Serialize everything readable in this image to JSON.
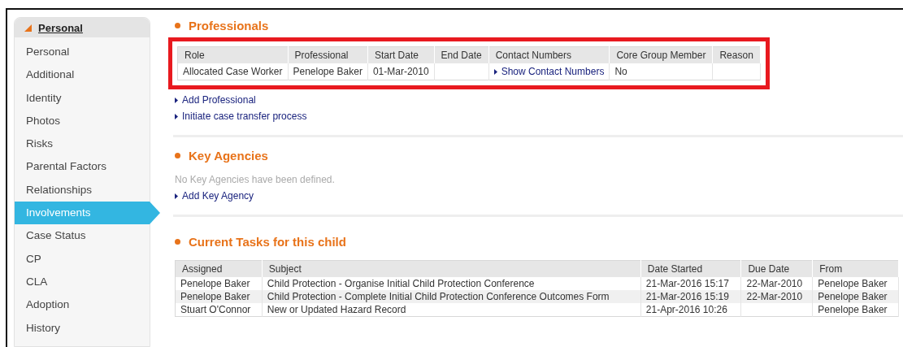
{
  "sidebar": {
    "header": "Personal",
    "items": [
      {
        "label": "Personal",
        "selected": false
      },
      {
        "label": "Additional",
        "selected": false
      },
      {
        "label": "Identity",
        "selected": false
      },
      {
        "label": "Photos",
        "selected": false
      },
      {
        "label": "Risks",
        "selected": false
      },
      {
        "label": "Parental Factors",
        "selected": false
      },
      {
        "label": "Relationships",
        "selected": false
      },
      {
        "label": "Involvements",
        "selected": true
      },
      {
        "label": "Case Status",
        "selected": false
      },
      {
        "label": "CP",
        "selected": false
      },
      {
        "label": "CLA",
        "selected": false
      },
      {
        "label": "Adoption",
        "selected": false
      },
      {
        "label": "History",
        "selected": false
      }
    ]
  },
  "professionals": {
    "title": "Professionals",
    "highlighted": true,
    "columns": [
      "Role",
      "Professional",
      "Start Date",
      "End Date",
      "Contact Numbers",
      "Core Group Member",
      "Reason"
    ],
    "rows": [
      [
        {
          "text": "Allocated Case Worker"
        },
        {
          "text": "Penelope Baker"
        },
        {
          "text": "01-Mar-2010"
        },
        {
          "text": ""
        },
        {
          "text": "Show Contact Numbers",
          "kind": "link"
        },
        {
          "text": "No"
        },
        {
          "text": ""
        }
      ]
    ],
    "links": [
      "Add Professional",
      "Initiate case transfer process"
    ]
  },
  "key_agencies": {
    "title": "Key Agencies",
    "empty_message": "No Key Agencies have been defined.",
    "links": [
      "Add Key Agency"
    ]
  },
  "current_tasks": {
    "title": "Current Tasks for this child",
    "columns": [
      "Assigned",
      "Subject",
      "Date Started",
      "Due Date",
      "From"
    ],
    "rows": [
      [
        "Penelope Baker",
        "Child Protection - Organise Initial Child Protection Conference",
        "21-Mar-2016 15:17",
        "22-Mar-2010",
        "Penelope Baker"
      ],
      [
        "Penelope Baker",
        "Child Protection - Complete Initial Child Protection Conference Outcomes Form",
        "21-Mar-2016 15:19",
        "22-Mar-2010",
        "Penelope Baker"
      ],
      [
        "Stuart O'Connor",
        "New or Updated Hazard Record",
        "21-Apr-2016 10:26",
        "",
        "Penelope Baker"
      ]
    ]
  }
}
